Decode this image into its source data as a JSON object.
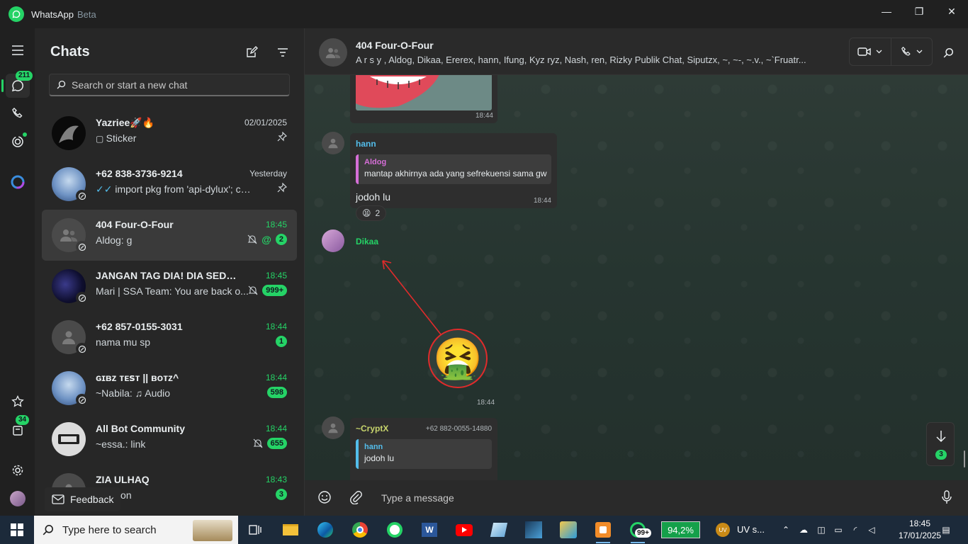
{
  "window": {
    "app_name": "WhatsApp",
    "app_tag": "Beta",
    "minimize": "—",
    "maximize": "❐",
    "close": "✕"
  },
  "rail": {
    "chats_badge": "211",
    "status_badge": "34"
  },
  "chatpane": {
    "title": "Chats",
    "search_placeholder": "Search or start a new chat",
    "feedback_label": "Feedback",
    "chats": [
      {
        "name": "Yazriee🚀🔥",
        "time": "02/01/2025",
        "preview": "Sticker",
        "preview_icon": "sticker-icon",
        "pinned": true
      },
      {
        "name": "+62 838-3736-9214",
        "time": "Yesterday",
        "preview": "import pkg from 'api-dylux'; const...",
        "preview_icon": "double-check-icon",
        "pinned": true
      },
      {
        "name": "404 Four-O-Four",
        "time": "18:45",
        "preview": "Aldog: g",
        "muted": true,
        "mention": "@",
        "count": "2"
      },
      {
        "name": "JANGAN TAG DIA! DIA SEDANG...",
        "time": "18:45",
        "preview": "Mari | SSA Team: You are back o...",
        "muted": true,
        "count": "999+"
      },
      {
        "name": "+62 857-0155-3031",
        "time": "18:44",
        "preview": "nama mu sp",
        "count": "1"
      },
      {
        "name": "ɢɪʙᴢ ᴛᴇꜱᴛ || ʙᴏᴛᴢ^",
        "time": "18:44",
        "preview": "~Nabila: ♫ Audio",
        "count": "598"
      },
      {
        "name": "All Bot Community",
        "time": "18:44",
        "preview": "~essa.: link",
        "muted": true,
        "count": "655"
      },
      {
        "name": "ZIA ULHAQ",
        "time": "18:43",
        "preview": "a button",
        "count": "3"
      }
    ]
  },
  "conversation": {
    "title": "404 Four-O-Four",
    "members": "A r s y , Aldog, Dikaa, Ererex, hann, Ifung, Kyz ryz, Nash, ren, Rizky Publik Chat, Siputzx, ~, ~-, ~.v., ~`Fruatr...",
    "messages": [
      {
        "time": "18:44"
      },
      {
        "sender": "hann",
        "quote_name": "Aldog",
        "quote_text": "mantap akhirnya ada yang sefrekuensi sama gw",
        "text": "jodoh lu",
        "time": "18:44",
        "reaction_emoji": "😫",
        "reaction_count": "2"
      },
      {
        "sender": "Dikaa",
        "sticker": "🤮",
        "time": "18:44"
      },
      {
        "sender": "~CryptX",
        "phone": "+62 882-0055-14880",
        "quote_name": "hann",
        "quote_text": "jodoh lu"
      }
    ],
    "scroll_badge": "3",
    "composer_placeholder": "Type a message"
  },
  "taskbar": {
    "search_placeholder": "Type here to search",
    "whatsapp_badge": "99+",
    "battery": "94,2%",
    "uv_label": "UV s...",
    "clock_time": "18:45",
    "clock_date": "17/01/2025"
  },
  "colors": {
    "accent": "#25d366",
    "quote_hann": "#53bdeb",
    "quote_aldog": "#d66ed7",
    "sender_hann": "#53bdeb",
    "sender_dikaa": "#25d366",
    "sender_cryptx": "#c7d46c"
  }
}
